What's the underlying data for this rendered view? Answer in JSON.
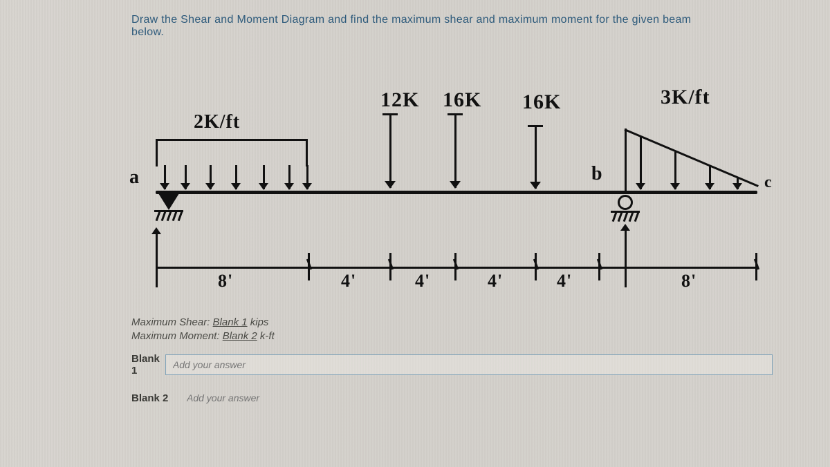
{
  "prompt": "Draw the Shear and Moment Diagram and find the maximum shear and maximum moment for the given beam below.",
  "loads": {
    "udl_label": "2K/ft",
    "tri_label": "3K/ft",
    "p1": "12K",
    "p2": "16K",
    "p3": "16K"
  },
  "points": {
    "a": "a",
    "b": "b",
    "c": "c"
  },
  "dims": {
    "d1": "8'",
    "d2": "4'",
    "d3": "4'",
    "d4": "4'",
    "d5": "4'",
    "d6": "8'"
  },
  "answers": {
    "shear_line_prefix": "Maximum Shear: ",
    "shear_blank": "Blank 1",
    "shear_units": " kips",
    "moment_line_prefix": "Maximum Moment: ",
    "moment_blank": "Blank 2",
    "moment_units": " k-ft",
    "blank1_label": "Blank 1",
    "blank2_label": "Blank 2",
    "placeholder": "Add your answer"
  }
}
